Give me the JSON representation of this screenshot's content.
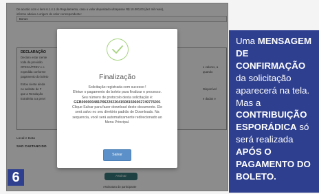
{
  "background_form": {
    "intro_line1": "De acordo com o item 6.1.4.1 do Regulamento, caso o valor depositado ultrapasse R$ 10.000,00 (dez mil reais),",
    "intro_line2": "informe abaixo a origem do valor correspondente:",
    "origin_value": "Bonus",
    "declaration_title": "DECLARAÇÃO",
    "declaration_lines": [
      "Declaro estar ciente",
      "toda da previsão",
      "OFESA/PREV e e",
      "expedida conforme",
      "pagamento do boleto",
      "Estou ciente ainda",
      "no website de F",
      "que a Resolução",
      "Extrafeito a a previ"
    ],
    "declaration_right": [
      "e valores, a",
      "quando"
    ],
    "declaration_right2": [
      "Disponível",
      "e dados e"
    ],
    "location_label": "Local e Data",
    "location_value": "SAO CAETANO DO",
    "button_label": "Assinar",
    "footer_label": "Assinatura do participante"
  },
  "modal": {
    "title": "Finalização",
    "line1": "Solicitação registrada com sucesso !",
    "line2": "Efetue o pagamento do boleto para finalizar o processo.",
    "line3": "Seu número de protocolo desta solicitação é:",
    "protocol": "GEB000000481P06220220415081506002749776001",
    "line4": "Clique Salvar para fazer download deste documento. Ele",
    "line5": "será salvo no seu diretório padrão de Downloads. Na",
    "line6": "sequencia, você será automaticamente redirecionado ao",
    "line7": "Menu Principal.",
    "save_label": "Salvar"
  },
  "step_number": "6",
  "caption": {
    "t1": "Uma",
    "b1": "MENSAGEM DE CONFIRMAÇÃO",
    "t2": "da solicitação aparecerá na tela. Mas a",
    "b2": "CONTRIBUIÇÃO ESPORÁDICA",
    "t3": "só será realizada",
    "b3": "APÓS O PAGAMENTO DO BOLETO.",
    "accent_color": "#2e3f8f"
  }
}
